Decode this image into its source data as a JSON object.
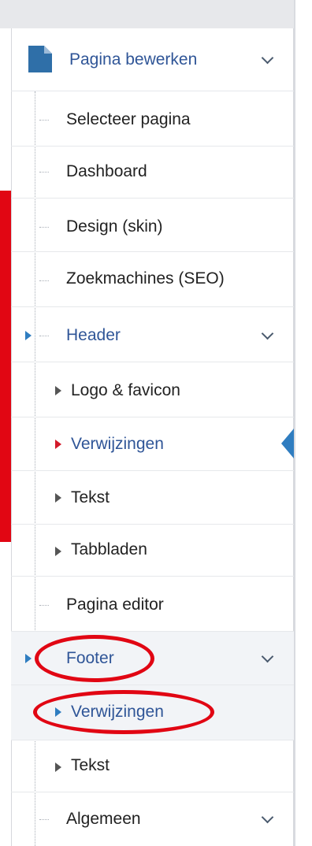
{
  "sidebar": {
    "header": {
      "label": "Pagina bewerken",
      "icon": "document-icon"
    },
    "items": [
      {
        "label": "Selecteer pagina"
      },
      {
        "label": "Dashboard"
      },
      {
        "label": "Design (skin)"
      },
      {
        "label": "Zoekmachines (SEO)"
      },
      {
        "label": "Header"
      },
      {
        "label": "Logo & favicon"
      },
      {
        "label": "Verwijzingen"
      },
      {
        "label": "Tekst"
      },
      {
        "label": "Tabbladen"
      },
      {
        "label": "Pagina editor"
      },
      {
        "label": "Footer"
      },
      {
        "label": "Verwijzingen"
      },
      {
        "label": "Tekst"
      },
      {
        "label": "Algemeen"
      }
    ]
  },
  "colors": {
    "accent": "#2f7dc0",
    "link": "#2f5597",
    "annotation_red": "#e10613"
  }
}
